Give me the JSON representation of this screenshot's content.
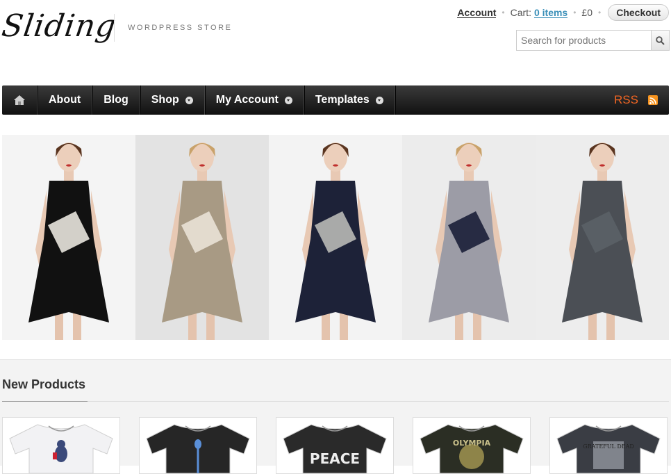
{
  "header": {
    "logo": "Sliding",
    "tagline": "WORDPRESS STORE",
    "account_label": "Account",
    "cart_label": "Cart:",
    "cart_items": "0 items",
    "cart_total": "£0",
    "checkout_label": "Checkout",
    "search_placeholder": "Search for products"
  },
  "nav": {
    "items": [
      {
        "label": "About",
        "dropdown": false
      },
      {
        "label": "Blog",
        "dropdown": false
      },
      {
        "label": "Shop",
        "dropdown": true
      },
      {
        "label": "My Account",
        "dropdown": true
      },
      {
        "label": "Templates",
        "dropdown": true
      }
    ],
    "rss_label": "RSS"
  },
  "slider": {
    "slides": [
      {
        "dress_color": "#111111",
        "accent": "#e9e6de"
      },
      {
        "dress_color": "#a89a84",
        "accent": "#e9e2d6"
      },
      {
        "dress_color": "#1d2238",
        "accent": "#b9b9b6"
      },
      {
        "dress_color": "#9c9ca6",
        "accent": "#1b1f38"
      },
      {
        "dress_color": "#4b4f55",
        "accent": "#5b6067"
      }
    ]
  },
  "section": {
    "title": "New Products",
    "products": [
      {
        "shirt_color": "#f2f2f4",
        "print": "bear-print"
      },
      {
        "shirt_color": "#262626",
        "print": "spoon-print"
      },
      {
        "shirt_color": "#2a2a2a",
        "print": "PEACE"
      },
      {
        "shirt_color": "#2b2e24",
        "print": "OLYMPIA"
      },
      {
        "shirt_color": "#3a3d44",
        "print": "GRATEFUL DEAD"
      }
    ]
  },
  "colors": {
    "link_blue": "#3a8fb8",
    "rss_orange": "#f26522",
    "nav_bg": "#1e1e1e"
  }
}
